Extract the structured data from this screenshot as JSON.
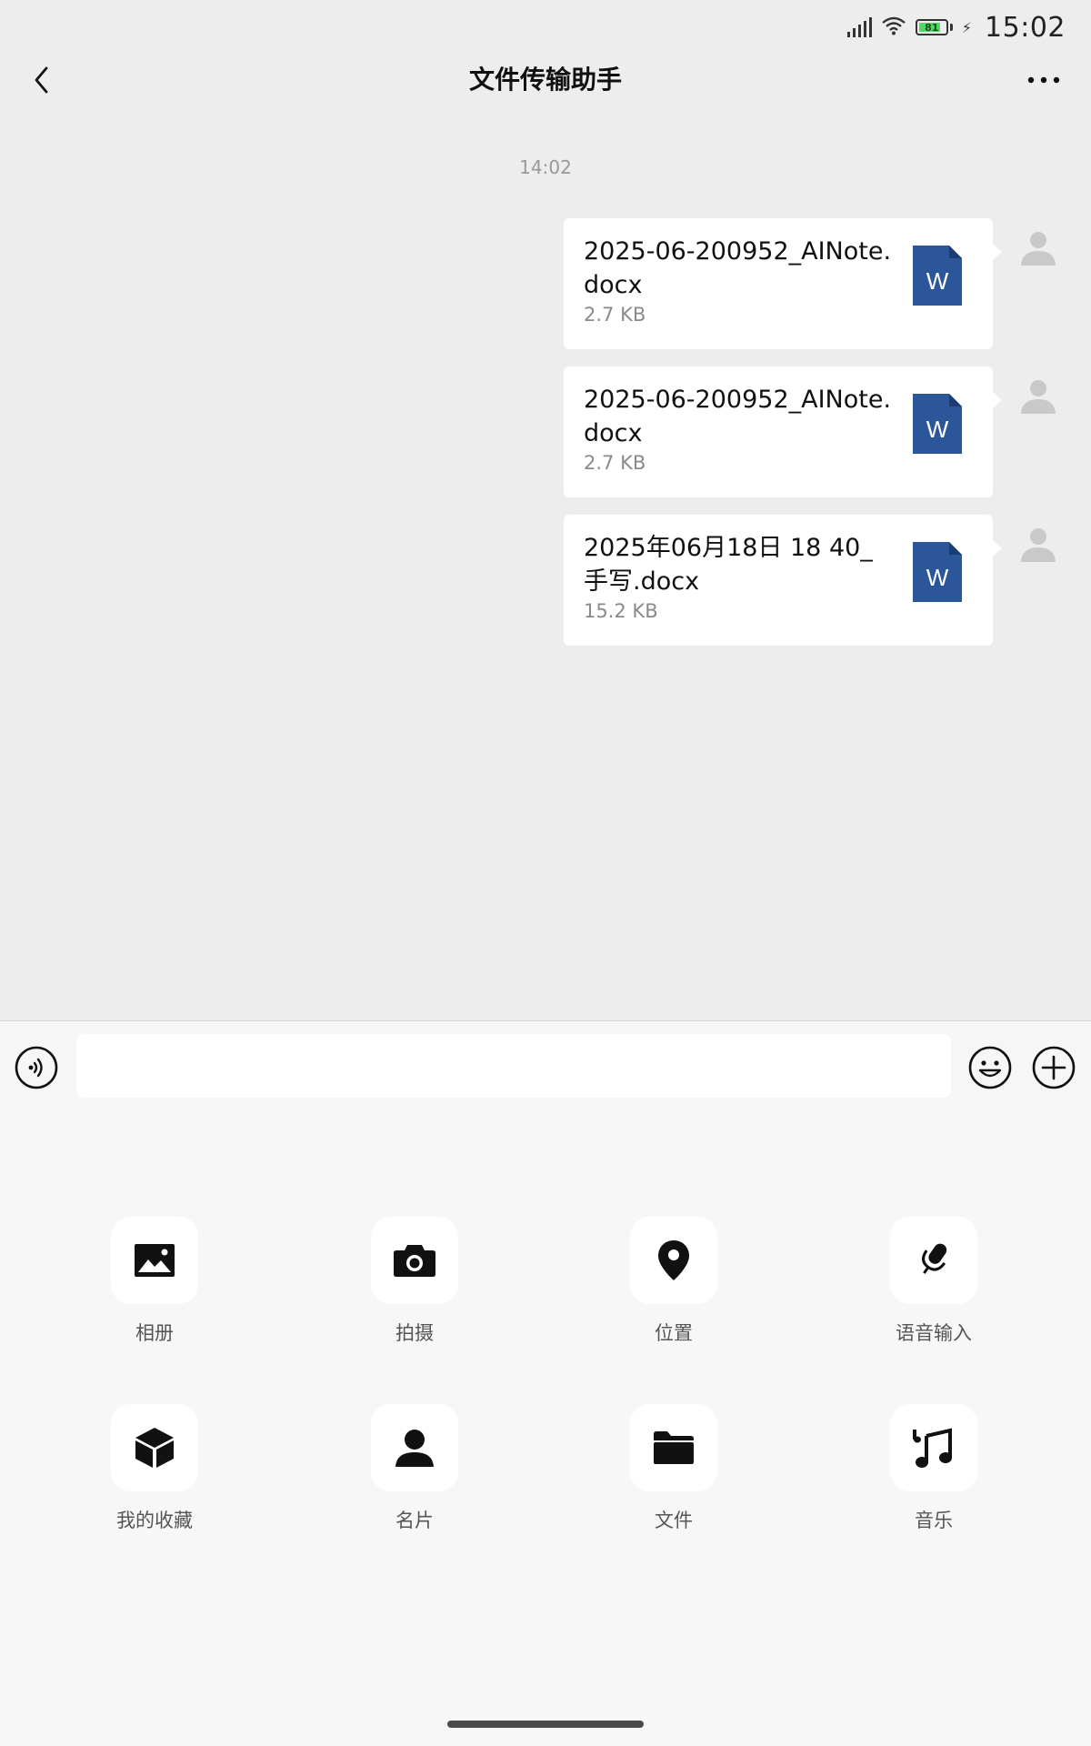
{
  "status_bar": {
    "time": "15:02",
    "battery_level": "81",
    "battery_percent": 81
  },
  "nav": {
    "title": "文件传输助手"
  },
  "chat": {
    "timestamp": "14:02",
    "messages": [
      {
        "file_name": "2025-06-200952_AINote.docx",
        "file_size": "2.7 KB",
        "file_type_letter": "W"
      },
      {
        "file_name": "2025-06-200952_AINote.docx",
        "file_size": "2.7 KB",
        "file_type_letter": "W"
      },
      {
        "file_name": "2025年06月18日 18 40_手写.docx",
        "file_size": "15.2 KB",
        "file_type_letter": "W"
      }
    ]
  },
  "input_bar": {
    "placeholder": "",
    "value": ""
  },
  "tools": [
    {
      "label": "相册",
      "icon": "image-icon"
    },
    {
      "label": "拍摄",
      "icon": "camera-icon"
    },
    {
      "label": "位置",
      "icon": "location-icon"
    },
    {
      "label": "语音输入",
      "icon": "microphone-icon"
    },
    {
      "label": "我的收藏",
      "icon": "cube-icon"
    },
    {
      "label": "名片",
      "icon": "person-icon"
    },
    {
      "label": "文件",
      "icon": "folder-icon"
    },
    {
      "label": "音乐",
      "icon": "music-icon"
    }
  ],
  "colors": {
    "background": "#ededed",
    "bubble": "#ffffff",
    "word_blue": "#2b579a",
    "battery_green": "#4cd964"
  }
}
